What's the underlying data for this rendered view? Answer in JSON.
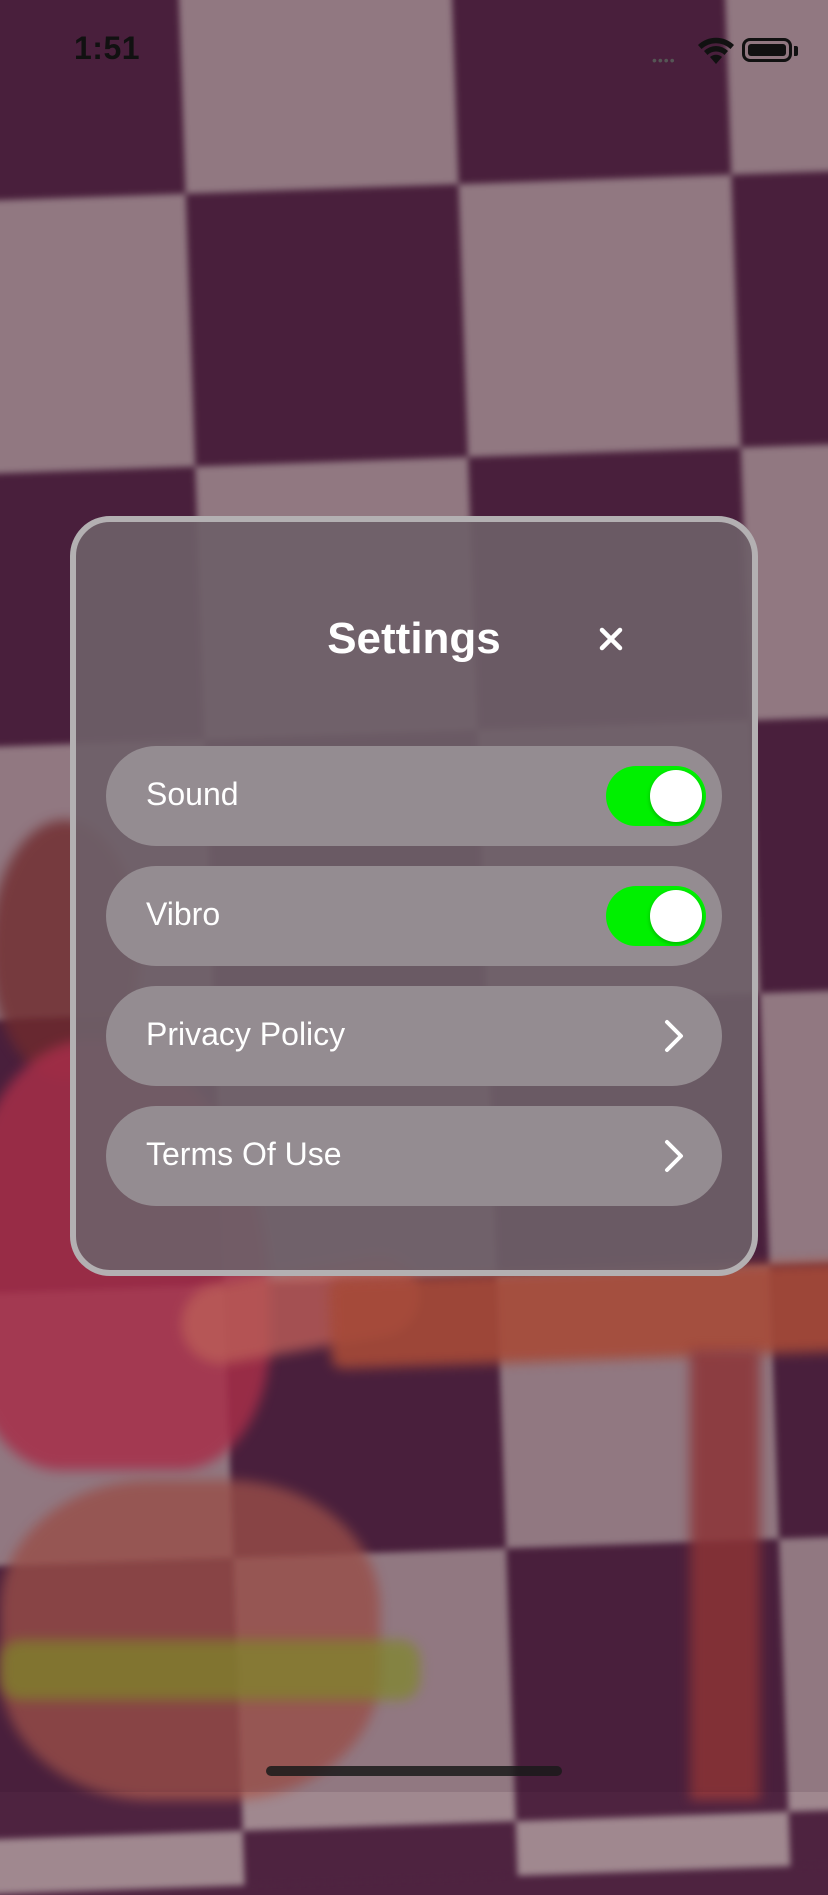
{
  "status_bar": {
    "time": "1:51",
    "signal_glyph": "••••",
    "wifi_icon": "wifi-icon",
    "battery_icon": "battery-icon"
  },
  "modal": {
    "title": "Settings",
    "close_icon": "close-icon",
    "rows": [
      {
        "label": "Sound",
        "control": "toggle",
        "on": true
      },
      {
        "label": "Vibro",
        "control": "toggle",
        "on": true
      },
      {
        "label": "Privacy Policy",
        "control": "chevron",
        "icon": "chevron-right-icon"
      },
      {
        "label": "Terms Of Use",
        "control": "chevron",
        "icon": "chevron-right-icon"
      }
    ]
  },
  "colors": {
    "toggle_on": "#00f000",
    "row_bg": "#948c91",
    "modal_bg": "#6e6068",
    "modal_border": "#b3b0b2"
  }
}
